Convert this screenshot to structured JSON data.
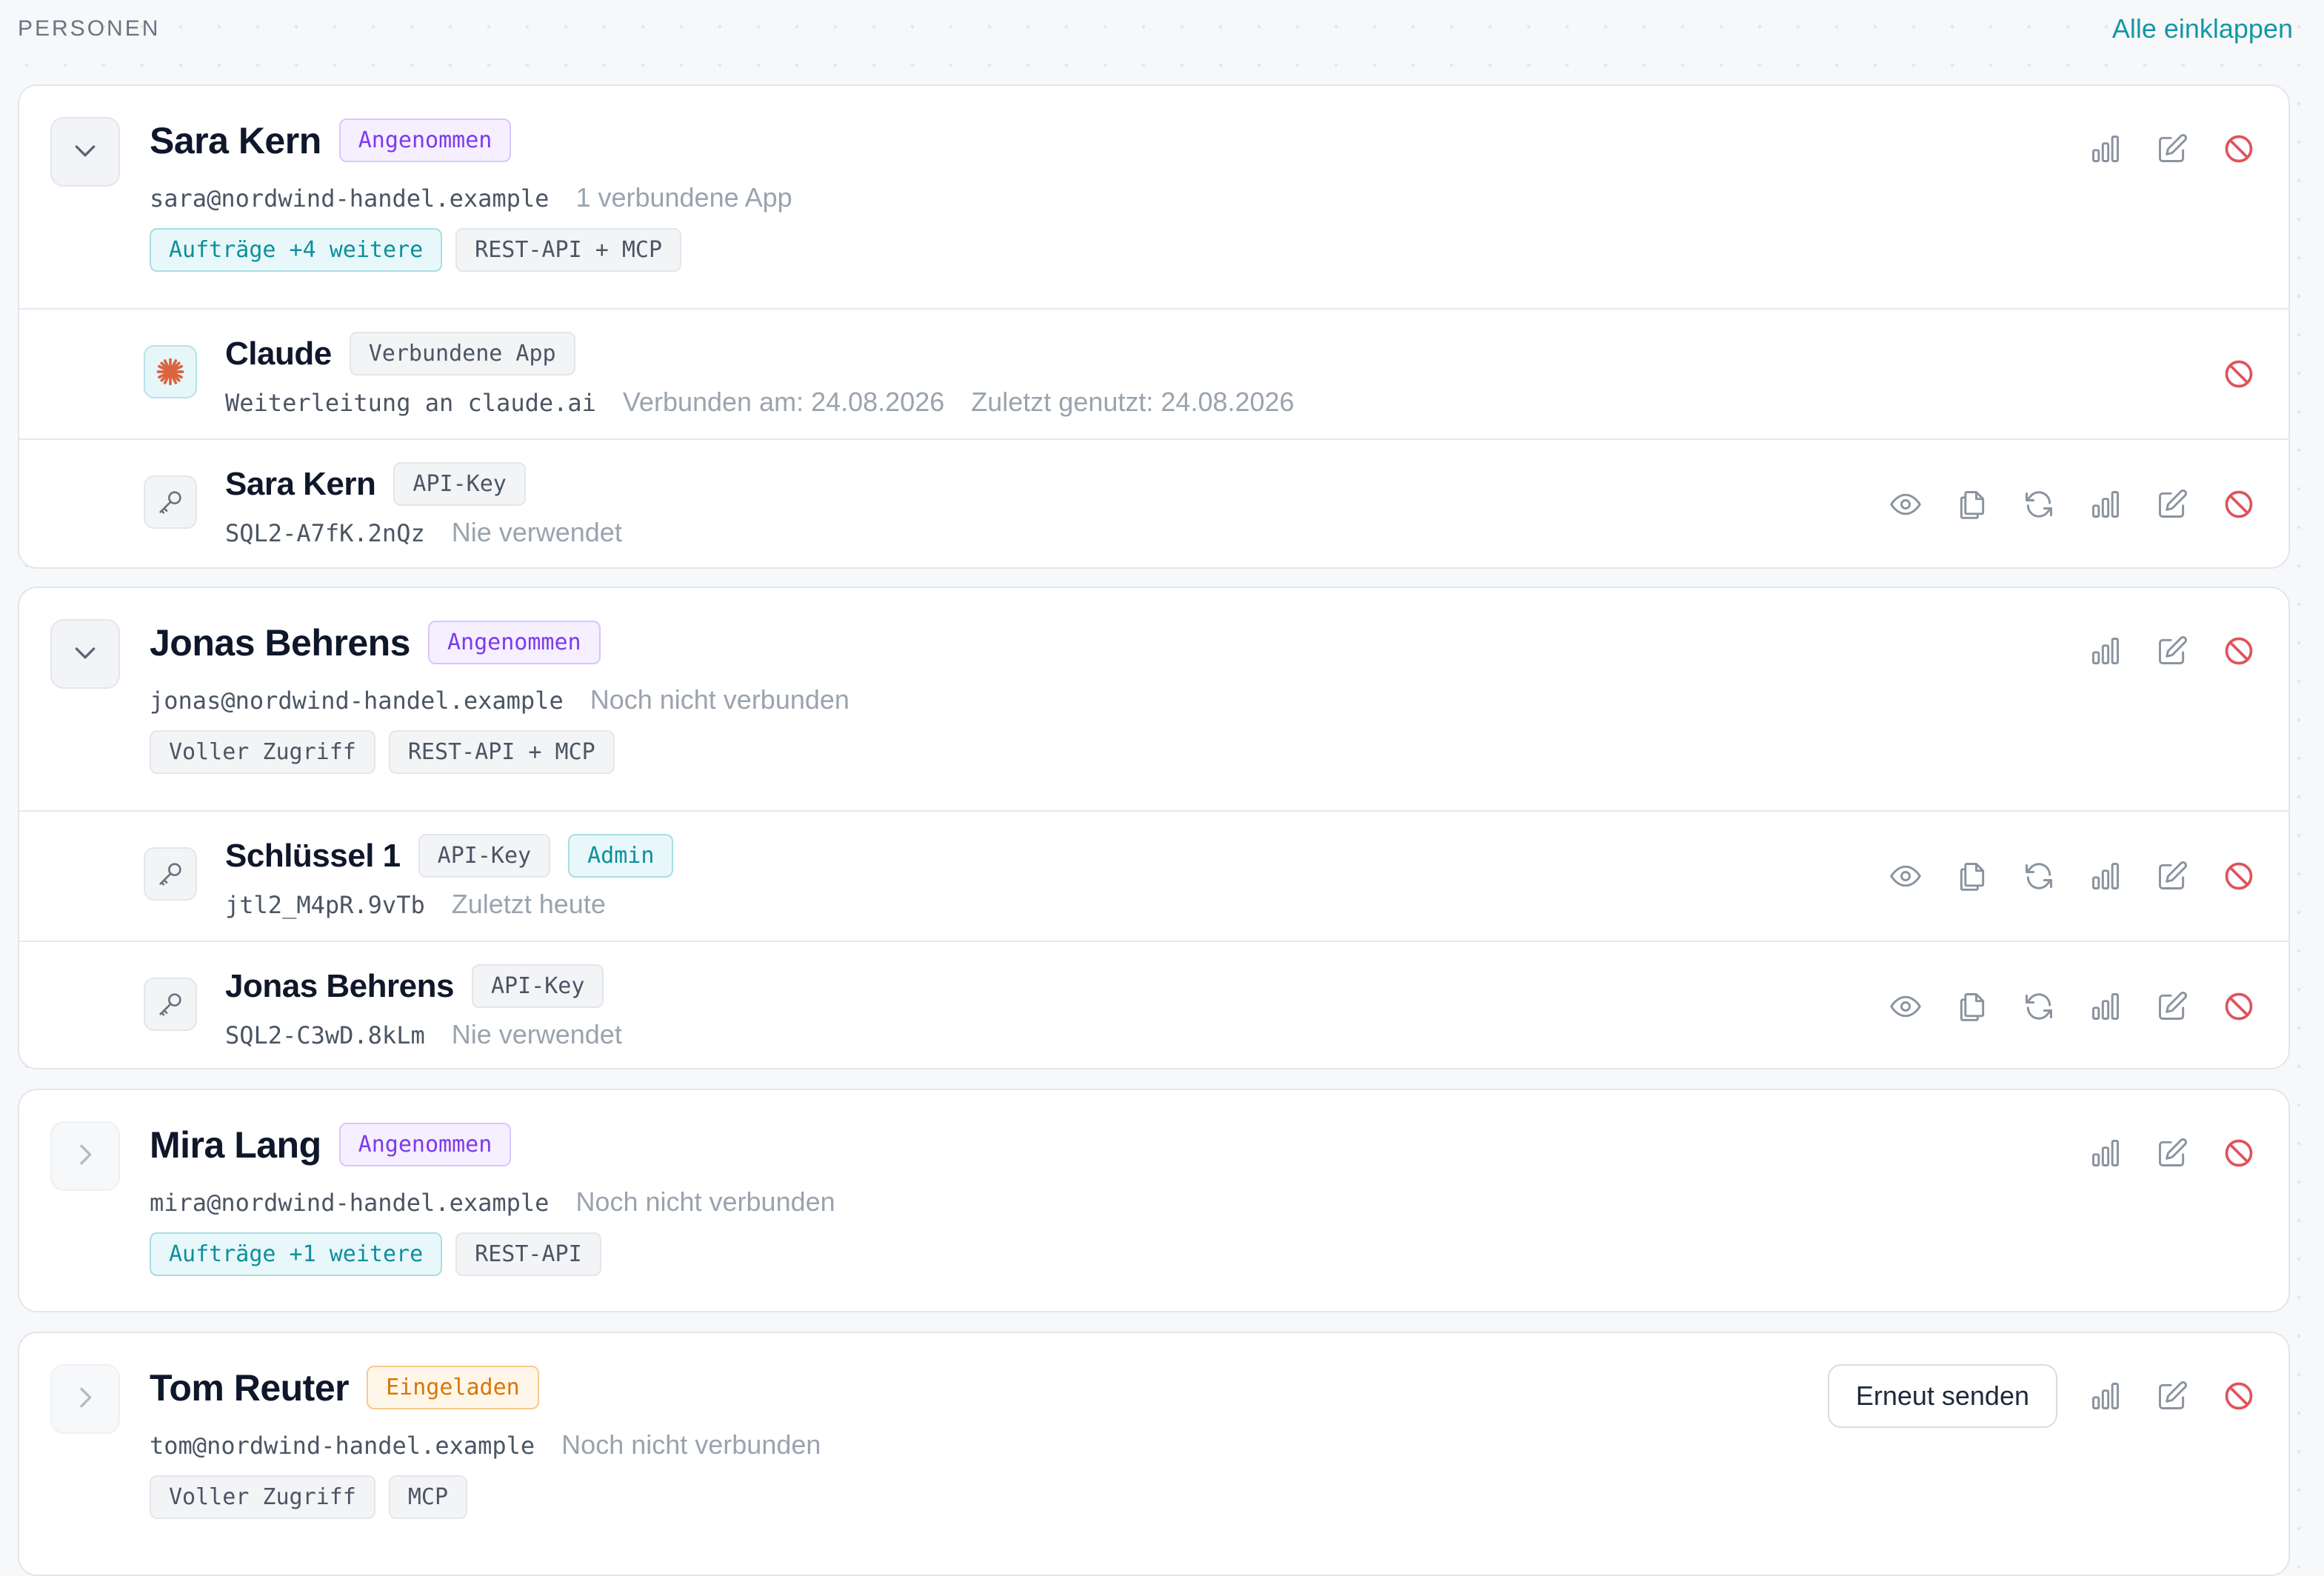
{
  "header": {
    "section_title": "PERSONEN",
    "collapse_all": "Alle einklappen"
  },
  "persons": [
    {
      "name": "Sara Kern",
      "status": "Angenommen",
      "email": "sara@nordwind-handel.example",
      "connection": "1 verbundene App",
      "tags": [
        "Aufträge +4 weitere",
        "REST-API + MCP"
      ],
      "subitems": [
        {
          "name": "Claude",
          "badge": "Verbundene App",
          "detail": "Weiterleitung an claude.ai",
          "meta1": "Verbunden am: 24.08.2026",
          "meta2": "Zuletzt genutzt: 24.08.2026"
        },
        {
          "name": "Sara Kern",
          "badge": "API-Key",
          "detail": "SQL2-A7fK.2nQz",
          "meta1": "Nie verwendet"
        }
      ]
    },
    {
      "name": "Jonas Behrens",
      "status": "Angenommen",
      "email": "jonas@nordwind-handel.example",
      "connection": "Noch nicht verbunden",
      "tags": [
        "Voller Zugriff",
        "REST-API + MCP"
      ],
      "subitems": [
        {
          "name": "Schlüssel 1",
          "badge": "API-Key",
          "badge2": "Admin",
          "detail": "jtl2_M4pR.9vTb",
          "meta1": "Zuletzt heute"
        },
        {
          "name": "Jonas Behrens",
          "badge": "API-Key",
          "detail": "SQL2-C3wD.8kLm",
          "meta1": "Nie verwendet"
        }
      ]
    },
    {
      "name": "Mira Lang",
      "status": "Angenommen",
      "email": "mira@nordwind-handel.example",
      "connection": "Noch nicht verbunden",
      "tags": [
        "Aufträge +1 weitere",
        "REST-API"
      ]
    },
    {
      "name": "Tom Reuter",
      "status": "Eingeladen",
      "email": "tom@nordwind-handel.example",
      "connection": "Noch nicht verbunden",
      "tags": [
        "Voller Zugriff",
        "MCP"
      ],
      "resend_label": "Erneut senden"
    }
  ],
  "icons": {
    "chart": "chart-icon",
    "edit": "edit-icon",
    "block": "block-icon",
    "view": "eye-icon",
    "copy": "copy-icon",
    "rotate": "refresh-icon",
    "key": "key-icon",
    "claude": "claude-logo-icon"
  },
  "colors": {
    "accent": "#1497a6",
    "danger": "#e0525a",
    "icon_gray": "#8a939e",
    "accepted": "#7c3aed",
    "invited": "#d97706"
  }
}
